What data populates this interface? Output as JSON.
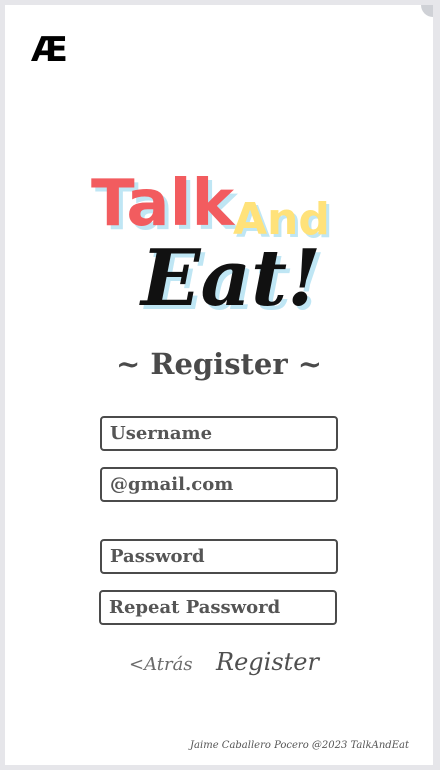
{
  "brand": {
    "mark": "Æ"
  },
  "logo": {
    "word1": "Talk",
    "word2": "And",
    "word3": "Eat!"
  },
  "page": {
    "title": "~ Register ~"
  },
  "form": {
    "username_placeholder": "Username",
    "email_placeholder": "@gmail.com",
    "password_placeholder": "Password",
    "repeat_password_placeholder": "Repeat Password"
  },
  "actions": {
    "back_label": "<Atrás",
    "register_label": "Register"
  },
  "footer": {
    "credit": "Jaime Caballero Pocero @2023 TalkAndEat"
  },
  "colors": {
    "talk": "#f25c5f",
    "and": "#ffe27a",
    "shadow": "#bfe6f4",
    "text": "#4a4a4a",
    "background": "#e6e6ea",
    "card": "#ffffff"
  }
}
